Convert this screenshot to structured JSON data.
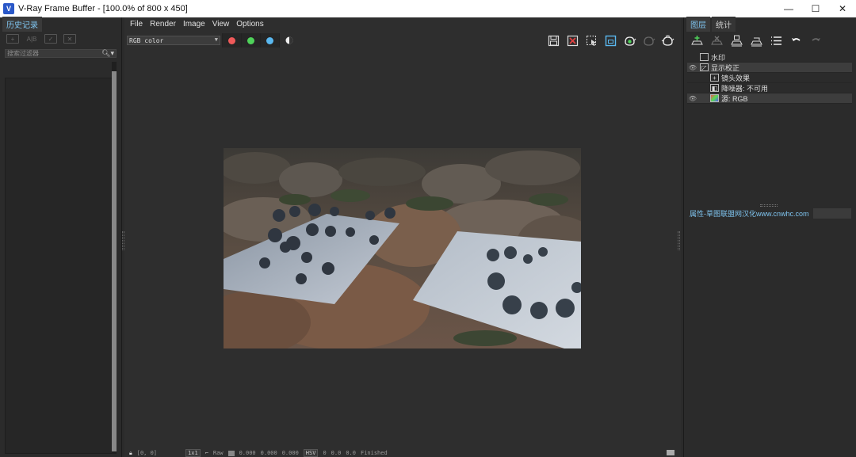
{
  "window": {
    "title": "V-Ray Frame Buffer - [100.0% of 800 x 450]",
    "controls": [
      "—",
      "☐",
      "✕"
    ]
  },
  "history_panel": {
    "tab_label": "历史记录",
    "filter_placeholder": "搜索过滤器"
  },
  "menu": {
    "items": [
      "File",
      "Render",
      "Image",
      "View",
      "Options"
    ]
  },
  "viewer": {
    "channel": "RGB color",
    "channel_dots": [
      {
        "name": "red-channel-button",
        "color": "#f05a5a"
      },
      {
        "name": "green-channel-button",
        "color": "#4fd35a"
      },
      {
        "name": "blue-channel-button",
        "color": "#5ab8f0"
      }
    ]
  },
  "status": {
    "coords": "[0, 0]",
    "zoom": "1x1",
    "mode": "Raw",
    "r": "0.000",
    "g": "0.000",
    "b": "0.000",
    "color_space": "HSV",
    "h": "0",
    "s": "0.0",
    "v": "0.0",
    "state": "Finished"
  },
  "right_panel": {
    "tabs": [
      "图层",
      "统计"
    ],
    "layers": [
      {
        "label": "水印",
        "eye": false,
        "indent": 1,
        "icon": "□"
      },
      {
        "label": "显示校正",
        "eye": true,
        "indent": 1,
        "icon": "◸"
      },
      {
        "label": "镜头效果",
        "eye": false,
        "indent": 2,
        "icon": "+"
      },
      {
        "label": "降噪器: 不可用",
        "eye": false,
        "indent": 2,
        "icon": "◧"
      },
      {
        "label": "源: RGB",
        "eye": true,
        "indent": 2,
        "icon": "▲"
      }
    ],
    "properties_label": "属性-草图联盟网汉化www.cnwhc.com"
  },
  "colors": {
    "accent_blue": "#7fc4ef",
    "panel_bg": "#2b2b2b",
    "viewer_bg": "#2e2e2e"
  }
}
